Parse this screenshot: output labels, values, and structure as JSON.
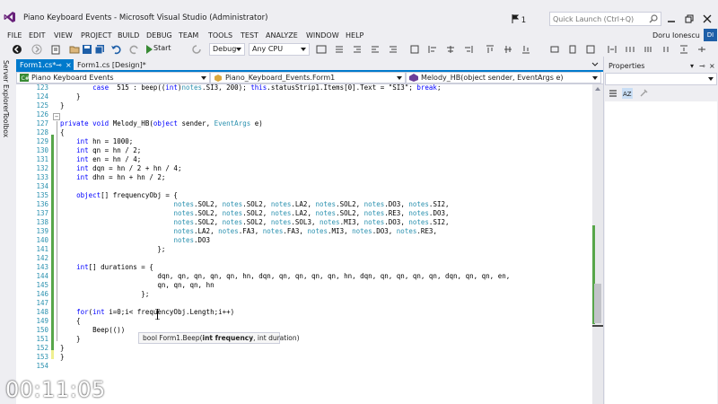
{
  "window": {
    "title": "Piano Keyboard Events - Microsoft Visual Studio (Administrator)",
    "notification_count": "1",
    "quick_launch_placeholder": "Quick Launch (Ctrl+Q)"
  },
  "menu": [
    "FILE",
    "EDIT",
    "VIEW",
    "PROJECT",
    "BUILD",
    "DEBUG",
    "TEAM",
    "TOOLS",
    "TEST",
    "ANALYZE",
    "WINDOW",
    "HELP"
  ],
  "user": {
    "name": "Doru Ionescu",
    "initials": "DI"
  },
  "toolbar": {
    "start_label": "Start",
    "configuration": "Debug",
    "platform": "Any CPU"
  },
  "side_tabs": [
    "Server Explorer",
    "Toolbox"
  ],
  "tabs": [
    {
      "label": "Form1.cs*",
      "active": true
    },
    {
      "label": "Form1.cs [Design]*",
      "active": false
    }
  ],
  "navbar": {
    "project": "Piano Keyboard Events",
    "class": "Piano_Keyboard_Events.Form1",
    "member": "Melody_HB(object sender, EventArgs e)"
  },
  "code": {
    "lines": [
      {
        "num": "123",
        "text": "        case  515 : beep((int)notes.SI3, 200); this.statusStrip1.Items[0].Text = \"SI3\"; break;"
      },
      {
        "num": "124",
        "text": "    }"
      },
      {
        "num": "125",
        "text": "}"
      },
      {
        "num": "126",
        "text": ""
      },
      {
        "num": "127",
        "text": "private void Melody_HB(object sender, EventArgs e)"
      },
      {
        "num": "128",
        "text": "{"
      },
      {
        "num": "129",
        "text": "    int hn = 1000;"
      },
      {
        "num": "130",
        "text": "    int qn = hn / 2;"
      },
      {
        "num": "131",
        "text": "    int en = hn / 4;"
      },
      {
        "num": "132",
        "text": "    int dqn = hn / 2 + hn / 4;"
      },
      {
        "num": "133",
        "text": "    int dhn = hn + hn / 2;"
      },
      {
        "num": "134",
        "text": ""
      },
      {
        "num": "135",
        "text": "    object[] frequencyObj = {"
      },
      {
        "num": "136",
        "text": "                            notes.SOL2, notes.SOL2, notes.LA2, notes.SOL2, notes.DO3, notes.SI2,"
      },
      {
        "num": "137",
        "text": "                            notes.SOL2, notes.SOL2, notes.LA2, notes.SOL2, notes.RE3, notes.DO3,"
      },
      {
        "num": "138",
        "text": "                            notes.SOL2, notes.SOL2, notes.SOL3, notes.MI3, notes.DO3, notes.SI2,"
      },
      {
        "num": "139",
        "text": "                            notes.LA2, notes.FA3, notes.FA3, notes.MI3, notes.DO3, notes.RE3,"
      },
      {
        "num": "140",
        "text": "                            notes.DO3"
      },
      {
        "num": "141",
        "text": "                        };"
      },
      {
        "num": "142",
        "text": ""
      },
      {
        "num": "143",
        "text": "    int[] durations = {"
      },
      {
        "num": "144",
        "text": "                        dqn, qn, qn, qn, qn, hn, dqn, qn, qn, qn, qn, hn, dqn, qn, qn, qn, qn, dqn, qn, qn, en,"
      },
      {
        "num": "145",
        "text": "                        qn, qn, qn, hn"
      },
      {
        "num": "146",
        "text": "                    };"
      },
      {
        "num": "147",
        "text": ""
      },
      {
        "num": "148",
        "text": "    for(int i=0;i< frequencyObj.Length;i++)"
      },
      {
        "num": "149",
        "text": "    {"
      },
      {
        "num": "150",
        "text": "        Beep(())"
      },
      {
        "num": "151",
        "text": "    }"
      },
      {
        "num": "152",
        "text": "}"
      },
      {
        "num": "153",
        "text": "}"
      },
      {
        "num": "154",
        "text": ""
      }
    ],
    "signature_tooltip": {
      "prefix": "bool Form1.Beep(",
      "bold_param": "int frequency",
      "suffix": ", int duration)"
    }
  },
  "properties_panel": {
    "title": "Properties"
  },
  "overlay": {
    "timestamp": "00:11:05"
  },
  "colors": {
    "accent": "#007acc",
    "keyword": "#0000ff",
    "type": "#2b91af",
    "line_number": "#2b91af",
    "changed_bar": "#57a64a"
  }
}
